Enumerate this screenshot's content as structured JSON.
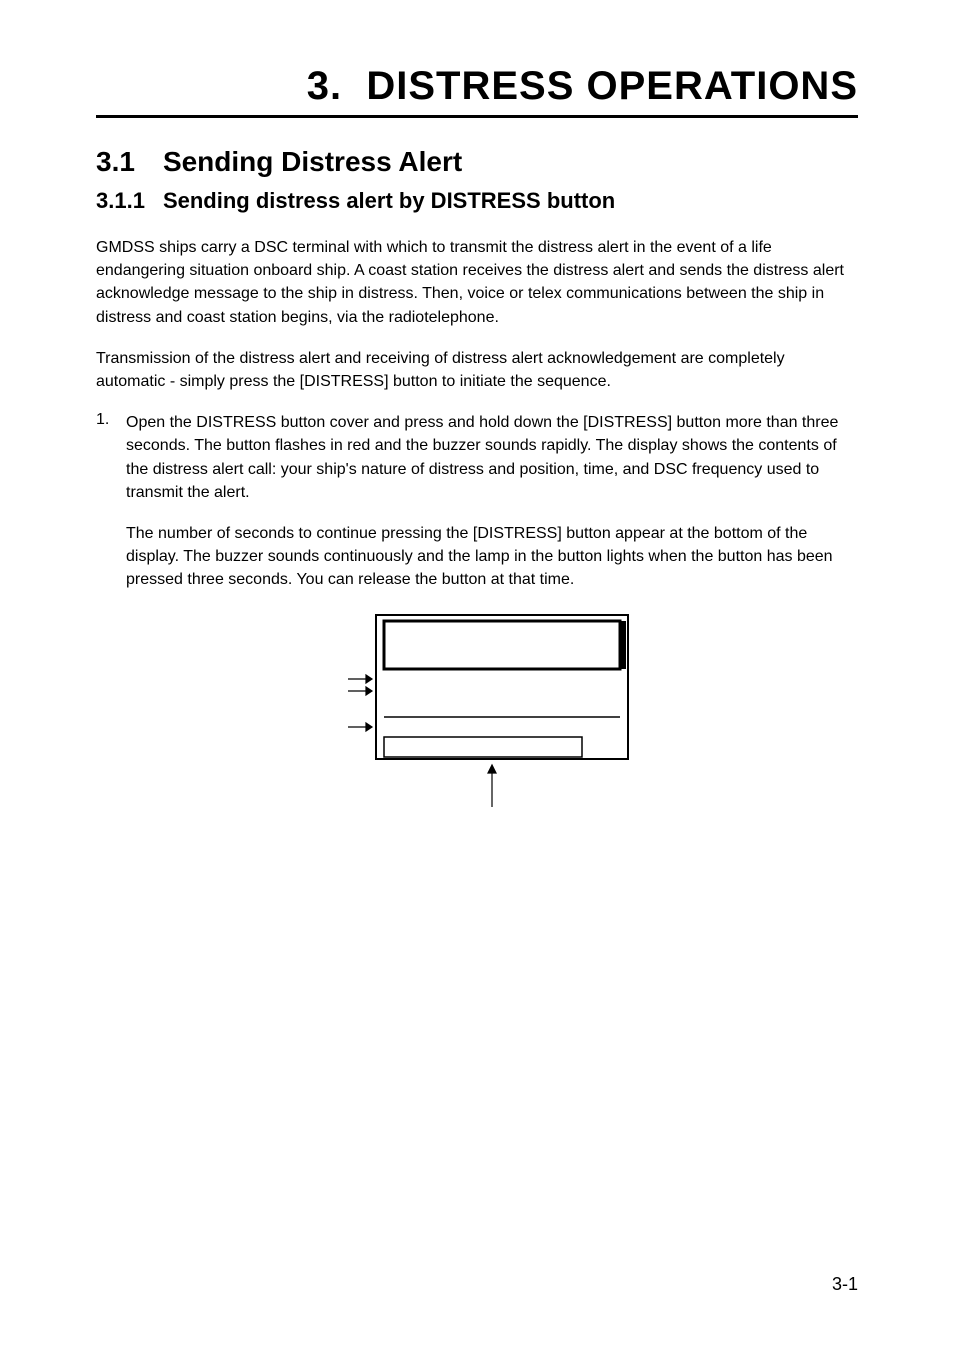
{
  "chapter": {
    "number": "3.",
    "title": "DISTRESS OPERATIONS"
  },
  "section": {
    "number": "3.1",
    "title": "Sending Distress Alert"
  },
  "subsection": {
    "number": "3.1.1",
    "title": "Sending distress alert by DISTRESS button"
  },
  "paragraphs": {
    "p1": "GMDSS ships carry a DSC terminal with which to transmit the distress alert in the event of a life endangering situation onboard ship. A coast station receives the distress alert and sends the distress alert acknowledge message to the ship in distress. Then, voice or telex communications between the ship in distress and coast station begins, via the radiotelephone.",
    "p2": "Transmission of the distress alert and receiving of distress alert acknowledgement are completely automatic - simply press the [DISTRESS] button to initiate the sequence."
  },
  "list": {
    "item1_num": "1.",
    "item1_text": "Open the DISTRESS button cover and press and hold down the [DISTRESS] button more than three seconds. The button flashes in red and the buzzer sounds rapidly. The display shows the contents of the distress alert call: your ship's nature of distress and position, time, and DSC frequency used to transmit the alert.",
    "item1_cont": "The number of seconds to continue pressing the [DISTRESS] button appear at the bottom of the display. The buzzer sounds continuously and the lamp in the button lights when the button has been pressed three seconds. You can release the button at that time."
  },
  "page_number": "3-1"
}
